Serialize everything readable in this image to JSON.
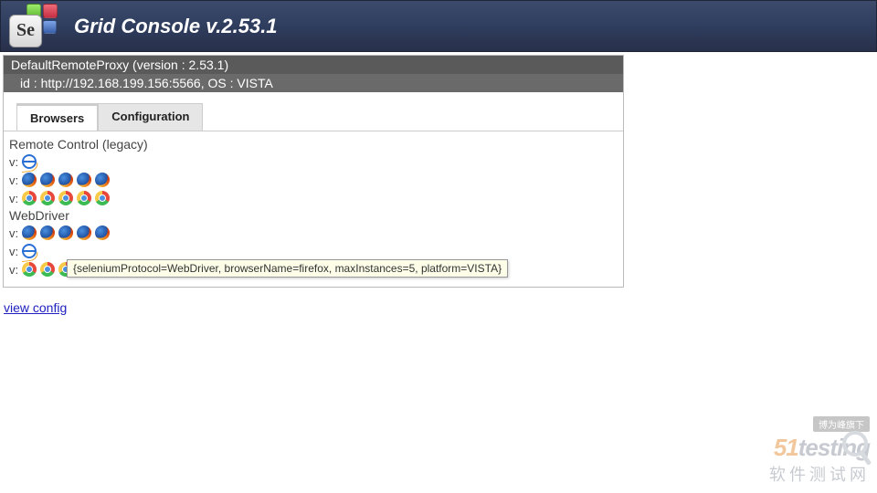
{
  "header": {
    "title": "Grid Console v.2.53.1"
  },
  "proxy": {
    "title": "DefaultRemoteProxy (version : 2.53.1)",
    "id_line": "id : http://192.168.199.156:5566, OS : VISTA"
  },
  "tabs": {
    "browsers": "Browsers",
    "configuration": "Configuration"
  },
  "sections": {
    "rc": "Remote Control (legacy)",
    "wd": "WebDriver"
  },
  "row_label": "v:",
  "rc_rows": [
    {
      "browser": "ie",
      "count": 1
    },
    {
      "browser": "firefox",
      "count": 5
    },
    {
      "browser": "chrome",
      "count": 5
    }
  ],
  "wd_rows": [
    {
      "browser": "firefox",
      "count": 5
    },
    {
      "browser": "ie",
      "count": 1
    },
    {
      "browser": "chrome",
      "count": 5
    }
  ],
  "tooltip": "{seleniumProtocol=WebDriver, browserName=firefox, maxInstances=5, platform=VISTA}",
  "view_config": "view config",
  "watermark": {
    "tag": "博为峰旗下",
    "brand_orange": "51",
    "brand_gray": "testing",
    "cn": "软件测试网"
  }
}
